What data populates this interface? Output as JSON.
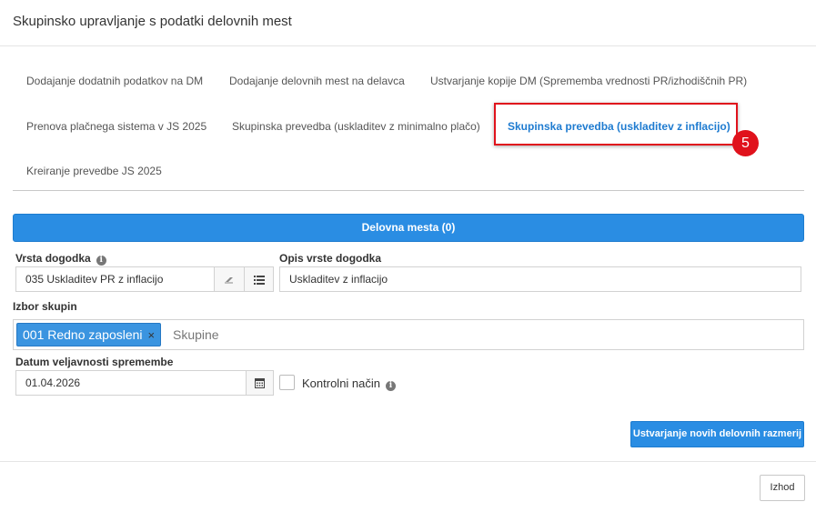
{
  "dialog": {
    "title": "Skupinsko upravljanje s podatki delovnih mest"
  },
  "tabs": [
    {
      "label": "Dodajanje dodatnih podatkov na DM"
    },
    {
      "label": "Dodajanje delovnih mest na delavca"
    },
    {
      "label": "Ustvarjanje kopije DM (Sprememba vrednosti PR/izhodiščnih PR)"
    },
    {
      "label": "Prenova plačnega sistema v JS 2025"
    },
    {
      "label": "Skupinska prevedba (uskladitev z minimalno plačo)"
    },
    {
      "label": "Skupinska prevedba (uskladitev z inflacijo)",
      "active": true
    },
    {
      "label": "Kreiranje prevedbe JS 2025"
    }
  ],
  "step_badge": "5",
  "delovna_mesta_button": "Delovna mesta (0)",
  "form": {
    "vrsta_dogodka": {
      "label": "Vrsta dogodka",
      "value": "035 Uskladitev PR z inflacijo"
    },
    "opis_vrste_dogodka": {
      "label": "Opis vrste dogodka",
      "value": "Uskladitev z inflacijo"
    },
    "izbor_skupin": {
      "label": "Izbor skupin",
      "tags": [
        "001 Redno zaposleni"
      ],
      "placeholder": "Skupine"
    },
    "datum_veljavnosti": {
      "label": "Datum veljavnosti spremembe",
      "value": "01.04.2026"
    },
    "kontrolni_nacin": {
      "label": "Kontrolni način",
      "checked": false
    }
  },
  "buttons": {
    "create": "Ustvarjanje novih delovnih razmerij",
    "exit": "Izhod"
  },
  "colors": {
    "primary": "#2a8de3",
    "active_tab": "#1e7bd0",
    "highlight": "#e0121c"
  }
}
